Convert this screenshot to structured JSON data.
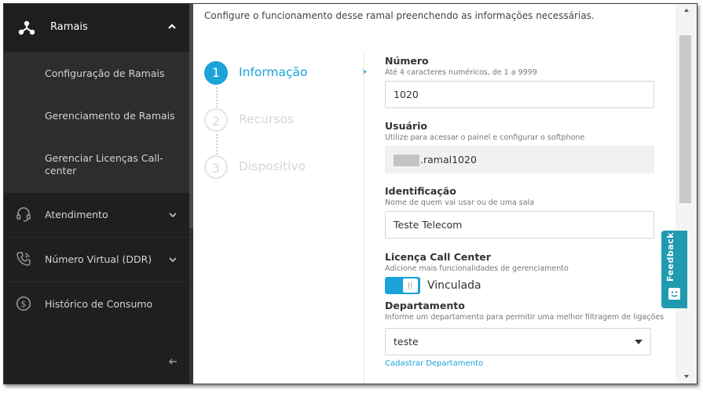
{
  "sidebar": {
    "section": {
      "label": "Ramais",
      "icon": "network-nodes-icon",
      "state": "expanded"
    },
    "subitems": [
      {
        "label": "Configuração de Ramais"
      },
      {
        "label": "Gerenciamento de Ramais"
      },
      {
        "label": "Gerenciar Licenças Call-center"
      }
    ],
    "items": [
      {
        "label": "Atendimento",
        "icon": "headset-icon"
      },
      {
        "label": "Número Virtual (DDR)",
        "icon": "phone-icon"
      },
      {
        "label": "Histórico de Consumo",
        "icon": "dollar-circle-icon"
      }
    ],
    "collapse_icon": "arrow-left-icon"
  },
  "content": {
    "intro": "Configure o funcionamento desse ramal preenchendo as informações necessárias."
  },
  "steps": [
    {
      "number": "1",
      "label": "Informação",
      "state": "active"
    },
    {
      "number": "2",
      "label": "Recursos",
      "state": "inactive"
    },
    {
      "number": "3",
      "label": "Dispositivo",
      "state": "inactive"
    }
  ],
  "form": {
    "numero": {
      "label": "Número",
      "help": "Até 4 caracteres numéricos, de 1 a 9999",
      "value": "1020"
    },
    "usuario": {
      "label": "Usuário",
      "help": "Utilize para acessar o painel e configurar o softphone",
      "value": ".ramal1020"
    },
    "identificacao": {
      "label": "Identificação",
      "help": "Nome de quem vai usar ou de uma sala",
      "value": "Teste Telecom"
    },
    "licenca": {
      "label": "Licença Call Center",
      "help": "Adicione mais funcionalidades de gerenciamento",
      "toggle_label": "Vinculada",
      "enabled": true
    },
    "departamento": {
      "label": "Departamento",
      "help": "Informe um departamento para permitir uma melhor filtragem de ligações",
      "value": "teste",
      "link": "Cadastrar Departamento"
    }
  },
  "feedback": {
    "label": "Feedback"
  },
  "colors": {
    "accent": "#1aa3d8",
    "sidebar": "#262626",
    "feedback": "#1f9ab0"
  }
}
